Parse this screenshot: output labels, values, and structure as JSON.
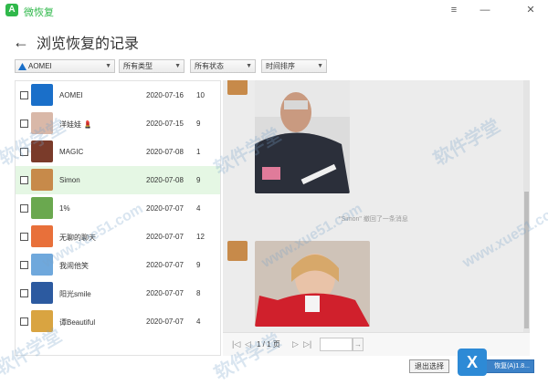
{
  "app": {
    "name": "微恢复",
    "logo_letter": "A"
  },
  "window_controls": {
    "menu": "≡",
    "minimize": "—",
    "close": "✕"
  },
  "header": {
    "back_glyph": "←",
    "title": "浏览恢复的记录"
  },
  "filters": {
    "account": "AOMEI",
    "type": "所有类型",
    "status": "所有状态",
    "sort": "时间排序"
  },
  "conversations": [
    {
      "name": "AOMEI",
      "date": "2020-07-16",
      "count": "10",
      "selected": false,
      "avatar_color": "#1a6fc9"
    },
    {
      "name": "洋娃娃 💄",
      "date": "2020-07-15",
      "count": "9",
      "selected": false,
      "avatar_color": "#d9b8a8"
    },
    {
      "name": "MAGIC",
      "date": "2020-07-08",
      "count": "1",
      "selected": false,
      "avatar_color": "#7a3b2a"
    },
    {
      "name": "Simon",
      "date": "2020-07-08",
      "count": "9",
      "selected": true,
      "avatar_color": "#c78a4a"
    },
    {
      "name": "1%",
      "date": "2020-07-07",
      "count": "4",
      "selected": false,
      "avatar_color": "#6aa84f"
    },
    {
      "name": "无聊的聊天",
      "date": "2020-07-07",
      "count": "12",
      "selected": false,
      "avatar_color": "#e8703a"
    },
    {
      "name": "我闹他笑",
      "date": "2020-07-07",
      "count": "9",
      "selected": false,
      "avatar_color": "#6fa8dc"
    },
    {
      "name": "阳光smile",
      "date": "2020-07-07",
      "count": "8",
      "selected": false,
      "avatar_color": "#2c5aa0"
    },
    {
      "name": "谭Beautiful",
      "date": "2020-07-07",
      "count": "4",
      "selected": false,
      "avatar_color": "#d9a441"
    }
  ],
  "chat": {
    "recall_note": "\"Simon\" 撤回了一条消息"
  },
  "pager": {
    "first": "|◁",
    "prev": "◁",
    "page_info": "1 / 1 页",
    "next": "▷",
    "last": "▷|",
    "go": "→",
    "page_input": ""
  },
  "footer": {
    "exit_label": "退出选择",
    "next_label": "恢复(A)1.8..."
  },
  "watermark": {
    "text": "软件学堂",
    "url": "www.xue51.com",
    "logo_glyph": "X"
  },
  "colors": {
    "accent": "#2fb84a",
    "selected_row": "#e5f7e4",
    "primary_button": "#3c82c8"
  }
}
